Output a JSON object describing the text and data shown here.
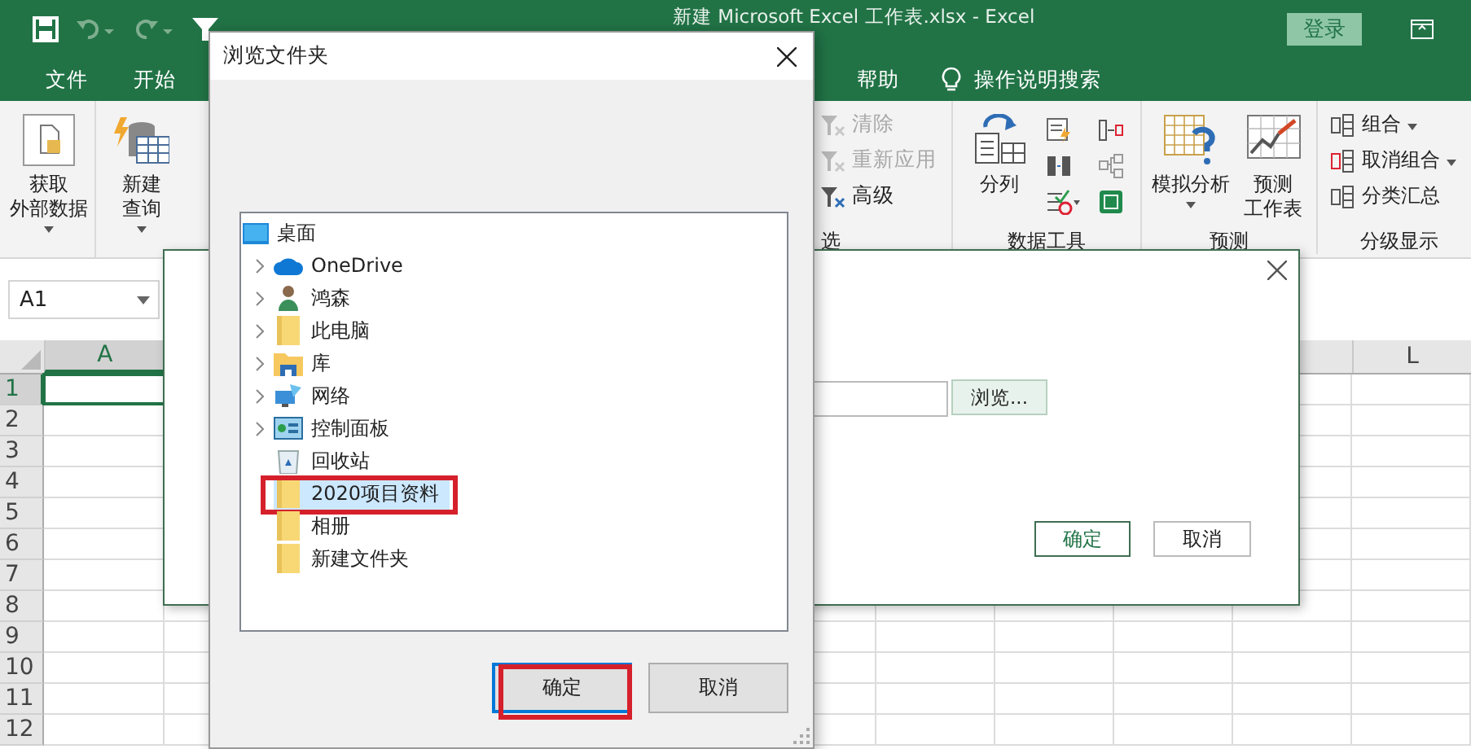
{
  "title_bar": {
    "title": "新建 Microsoft Excel 工作表.xlsx  -  Excel",
    "login": "登录"
  },
  "ribbon_tabs": [
    {
      "label": "文件",
      "selected": false
    },
    {
      "label": "开始",
      "selected": false
    }
  ],
  "ribbon_tabs_right": [
    {
      "label": "帮助",
      "selected": false
    }
  ],
  "search_hint": "操作说明搜索",
  "ribbon_left": [
    {
      "kind": "big",
      "lines": [
        "获取",
        "外部数据"
      ],
      "dropdown": true
    },
    {
      "kind": "big",
      "lines": [
        "新建",
        "查询"
      ],
      "dropdown": true
    }
  ],
  "ribbon_right": [
    {
      "label": "选",
      "items": [
        {
          "kind": "small",
          "label": "清除",
          "disabled": true
        },
        {
          "kind": "small",
          "label": "重新应用",
          "disabled": true
        },
        {
          "kind": "small",
          "label": "高级",
          "disabled": false
        }
      ]
    },
    {
      "label": "数据工具",
      "items": [
        {
          "kind": "big",
          "lines": [
            "分列"
          ]
        },
        {
          "kind": "tool-icons"
        }
      ]
    },
    {
      "label": "预测",
      "items": [
        {
          "kind": "big",
          "lines": [
            "模拟分析"
          ],
          "dropdown": true
        },
        {
          "kind": "big",
          "lines": [
            "预测",
            "工作表"
          ]
        }
      ]
    },
    {
      "label": "分级显示",
      "items": [
        {
          "kind": "small",
          "label": "组合",
          "dropdown": true
        },
        {
          "kind": "small",
          "label": "取消组合",
          "dropdown": true
        },
        {
          "kind": "small",
          "label": "分类汇总"
        }
      ]
    }
  ],
  "name_box": "A1",
  "columns": [
    "A",
    "L"
  ],
  "rows": [
    "1",
    "2",
    "3",
    "4",
    "5",
    "6",
    "7",
    "8",
    "9",
    "10",
    "11",
    "12"
  ],
  "back_dialog": {
    "browse_button": "浏览...",
    "ok": "确定",
    "cancel": "取消"
  },
  "browse_dialog": {
    "title": "浏览文件夹",
    "tree": {
      "label": "桌面",
      "children": [
        {
          "label": "OneDrive",
          "expandable": true,
          "selected": false,
          "annotated": false
        },
        {
          "label": "鸿森",
          "expandable": true,
          "selected": false,
          "annotated": false
        },
        {
          "label": "此电脑",
          "expandable": true,
          "selected": false,
          "annotated": false
        },
        {
          "label": "库",
          "expandable": true,
          "selected": false,
          "annotated": false
        },
        {
          "label": "网络",
          "expandable": true,
          "selected": false,
          "annotated": false
        },
        {
          "label": "控制面板",
          "expandable": true,
          "selected": false,
          "annotated": false
        },
        {
          "label": "回收站",
          "expandable": false,
          "selected": false,
          "annotated": false
        },
        {
          "label": "2020项目资料",
          "expandable": false,
          "selected": true,
          "annotated": true
        },
        {
          "label": "相册",
          "expandable": false,
          "selected": false,
          "annotated": false
        },
        {
          "label": "新建文件夹",
          "expandable": false,
          "selected": false,
          "annotated": false
        }
      ]
    },
    "ok": {
      "label": "确定",
      "focused": true,
      "annotated": true
    },
    "cancel": {
      "label": "取消",
      "focused": false,
      "annotated": false
    }
  }
}
